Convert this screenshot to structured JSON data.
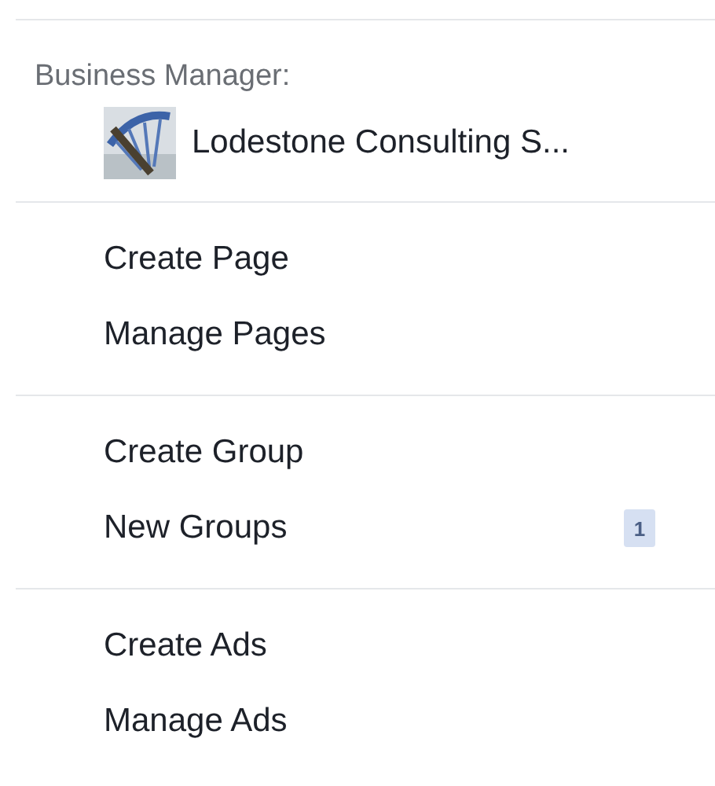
{
  "business_manager": {
    "label": "Business Manager:",
    "account": "Lodestone Consulting S..."
  },
  "sections": [
    {
      "items": [
        {
          "label": "Create Page"
        },
        {
          "label": "Manage Pages"
        }
      ]
    },
    {
      "items": [
        {
          "label": "Create Group"
        },
        {
          "label": "New Groups",
          "badge": "1"
        }
      ]
    },
    {
      "items": [
        {
          "label": "Create Ads"
        },
        {
          "label": "Manage Ads"
        }
      ]
    }
  ]
}
